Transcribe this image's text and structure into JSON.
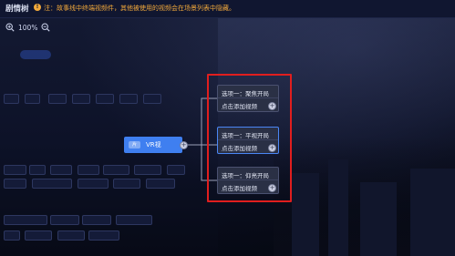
{
  "header": {
    "title": "剧情树",
    "notice_icon": "!",
    "notice": "注：故事线中终端视频件，其他被使用的视频会在场景列表中隐藏。"
  },
  "zoom": {
    "level": "100%"
  },
  "vr_node": {
    "tag": "片",
    "label": "VR视"
  },
  "options": [
    {
      "title": "选项一：聚焦开局",
      "add_label": "点击添加视频"
    },
    {
      "title": "选项一：平视开局",
      "add_label": "点击添加视频"
    },
    {
      "title": "选项一：仰亮开局",
      "add_label": "点击添加视频"
    }
  ],
  "colors": {
    "accent": "#3f7ff0",
    "highlight": "#e01e1e",
    "notice": "#f2a93b"
  }
}
